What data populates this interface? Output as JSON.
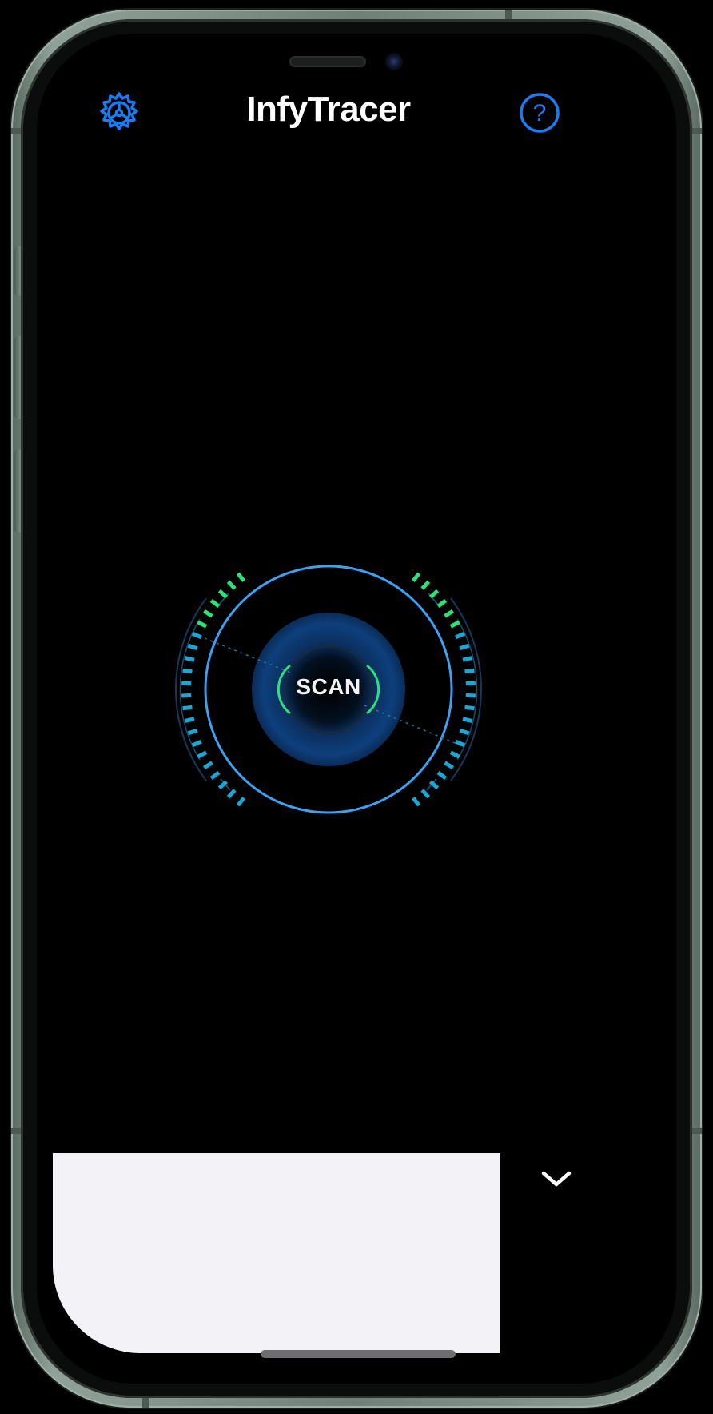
{
  "app": {
    "title": "InfyTracer"
  },
  "header": {
    "settings_icon": "gear-icon",
    "help_icon": "question-circle-icon"
  },
  "scanner": {
    "label": "SCAN"
  },
  "bottom_sheet": {
    "collapse_icon": "chevron-down-icon"
  },
  "colors": {
    "accent_blue": "#1e7cf2",
    "ring_blue": "#3ea0f0",
    "meter_green": "#2ee07a",
    "meter_cyan": "#1ba7d6",
    "background": "#000000",
    "sheet": "#f2f2f7"
  }
}
